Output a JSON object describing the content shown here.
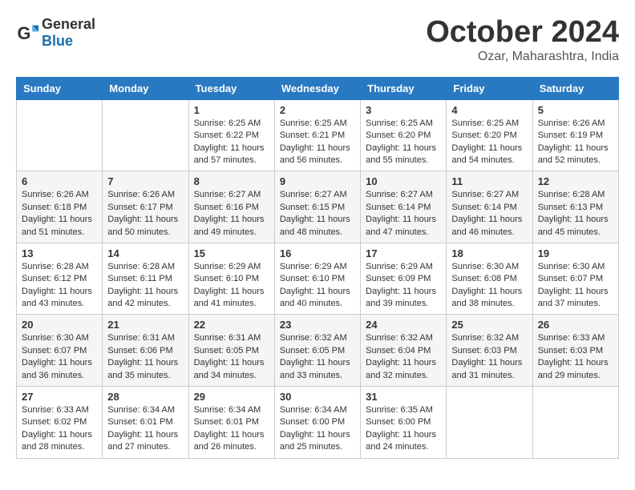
{
  "header": {
    "logo_general": "General",
    "logo_blue": "Blue",
    "month_title": "October 2024",
    "location": "Ozar, Maharashtra, India"
  },
  "calendar": {
    "days_of_week": [
      "Sunday",
      "Monday",
      "Tuesday",
      "Wednesday",
      "Thursday",
      "Friday",
      "Saturday"
    ],
    "weeks": [
      [
        {
          "day": "",
          "sunrise": "",
          "sunset": "",
          "daylight": ""
        },
        {
          "day": "",
          "sunrise": "",
          "sunset": "",
          "daylight": ""
        },
        {
          "day": "1",
          "sunrise": "Sunrise: 6:25 AM",
          "sunset": "Sunset: 6:22 PM",
          "daylight": "Daylight: 11 hours and 57 minutes."
        },
        {
          "day": "2",
          "sunrise": "Sunrise: 6:25 AM",
          "sunset": "Sunset: 6:21 PM",
          "daylight": "Daylight: 11 hours and 56 minutes."
        },
        {
          "day": "3",
          "sunrise": "Sunrise: 6:25 AM",
          "sunset": "Sunset: 6:20 PM",
          "daylight": "Daylight: 11 hours and 55 minutes."
        },
        {
          "day": "4",
          "sunrise": "Sunrise: 6:25 AM",
          "sunset": "Sunset: 6:20 PM",
          "daylight": "Daylight: 11 hours and 54 minutes."
        },
        {
          "day": "5",
          "sunrise": "Sunrise: 6:26 AM",
          "sunset": "Sunset: 6:19 PM",
          "daylight": "Daylight: 11 hours and 52 minutes."
        }
      ],
      [
        {
          "day": "6",
          "sunrise": "Sunrise: 6:26 AM",
          "sunset": "Sunset: 6:18 PM",
          "daylight": "Daylight: 11 hours and 51 minutes."
        },
        {
          "day": "7",
          "sunrise": "Sunrise: 6:26 AM",
          "sunset": "Sunset: 6:17 PM",
          "daylight": "Daylight: 11 hours and 50 minutes."
        },
        {
          "day": "8",
          "sunrise": "Sunrise: 6:27 AM",
          "sunset": "Sunset: 6:16 PM",
          "daylight": "Daylight: 11 hours and 49 minutes."
        },
        {
          "day": "9",
          "sunrise": "Sunrise: 6:27 AM",
          "sunset": "Sunset: 6:15 PM",
          "daylight": "Daylight: 11 hours and 48 minutes."
        },
        {
          "day": "10",
          "sunrise": "Sunrise: 6:27 AM",
          "sunset": "Sunset: 6:14 PM",
          "daylight": "Daylight: 11 hours and 47 minutes."
        },
        {
          "day": "11",
          "sunrise": "Sunrise: 6:27 AM",
          "sunset": "Sunset: 6:14 PM",
          "daylight": "Daylight: 11 hours and 46 minutes."
        },
        {
          "day": "12",
          "sunrise": "Sunrise: 6:28 AM",
          "sunset": "Sunset: 6:13 PM",
          "daylight": "Daylight: 11 hours and 45 minutes."
        }
      ],
      [
        {
          "day": "13",
          "sunrise": "Sunrise: 6:28 AM",
          "sunset": "Sunset: 6:12 PM",
          "daylight": "Daylight: 11 hours and 43 minutes."
        },
        {
          "day": "14",
          "sunrise": "Sunrise: 6:28 AM",
          "sunset": "Sunset: 6:11 PM",
          "daylight": "Daylight: 11 hours and 42 minutes."
        },
        {
          "day": "15",
          "sunrise": "Sunrise: 6:29 AM",
          "sunset": "Sunset: 6:10 PM",
          "daylight": "Daylight: 11 hours and 41 minutes."
        },
        {
          "day": "16",
          "sunrise": "Sunrise: 6:29 AM",
          "sunset": "Sunset: 6:10 PM",
          "daylight": "Daylight: 11 hours and 40 minutes."
        },
        {
          "day": "17",
          "sunrise": "Sunrise: 6:29 AM",
          "sunset": "Sunset: 6:09 PM",
          "daylight": "Daylight: 11 hours and 39 minutes."
        },
        {
          "day": "18",
          "sunrise": "Sunrise: 6:30 AM",
          "sunset": "Sunset: 6:08 PM",
          "daylight": "Daylight: 11 hours and 38 minutes."
        },
        {
          "day": "19",
          "sunrise": "Sunrise: 6:30 AM",
          "sunset": "Sunset: 6:07 PM",
          "daylight": "Daylight: 11 hours and 37 minutes."
        }
      ],
      [
        {
          "day": "20",
          "sunrise": "Sunrise: 6:30 AM",
          "sunset": "Sunset: 6:07 PM",
          "daylight": "Daylight: 11 hours and 36 minutes."
        },
        {
          "day": "21",
          "sunrise": "Sunrise: 6:31 AM",
          "sunset": "Sunset: 6:06 PM",
          "daylight": "Daylight: 11 hours and 35 minutes."
        },
        {
          "day": "22",
          "sunrise": "Sunrise: 6:31 AM",
          "sunset": "Sunset: 6:05 PM",
          "daylight": "Daylight: 11 hours and 34 minutes."
        },
        {
          "day": "23",
          "sunrise": "Sunrise: 6:32 AM",
          "sunset": "Sunset: 6:05 PM",
          "daylight": "Daylight: 11 hours and 33 minutes."
        },
        {
          "day": "24",
          "sunrise": "Sunrise: 6:32 AM",
          "sunset": "Sunset: 6:04 PM",
          "daylight": "Daylight: 11 hours and 32 minutes."
        },
        {
          "day": "25",
          "sunrise": "Sunrise: 6:32 AM",
          "sunset": "Sunset: 6:03 PM",
          "daylight": "Daylight: 11 hours and 31 minutes."
        },
        {
          "day": "26",
          "sunrise": "Sunrise: 6:33 AM",
          "sunset": "Sunset: 6:03 PM",
          "daylight": "Daylight: 11 hours and 29 minutes."
        }
      ],
      [
        {
          "day": "27",
          "sunrise": "Sunrise: 6:33 AM",
          "sunset": "Sunset: 6:02 PM",
          "daylight": "Daylight: 11 hours and 28 minutes."
        },
        {
          "day": "28",
          "sunrise": "Sunrise: 6:34 AM",
          "sunset": "Sunset: 6:01 PM",
          "daylight": "Daylight: 11 hours and 27 minutes."
        },
        {
          "day": "29",
          "sunrise": "Sunrise: 6:34 AM",
          "sunset": "Sunset: 6:01 PM",
          "daylight": "Daylight: 11 hours and 26 minutes."
        },
        {
          "day": "30",
          "sunrise": "Sunrise: 6:34 AM",
          "sunset": "Sunset: 6:00 PM",
          "daylight": "Daylight: 11 hours and 25 minutes."
        },
        {
          "day": "31",
          "sunrise": "Sunrise: 6:35 AM",
          "sunset": "Sunset: 6:00 PM",
          "daylight": "Daylight: 11 hours and 24 minutes."
        },
        {
          "day": "",
          "sunrise": "",
          "sunset": "",
          "daylight": ""
        },
        {
          "day": "",
          "sunrise": "",
          "sunset": "",
          "daylight": ""
        }
      ]
    ]
  }
}
